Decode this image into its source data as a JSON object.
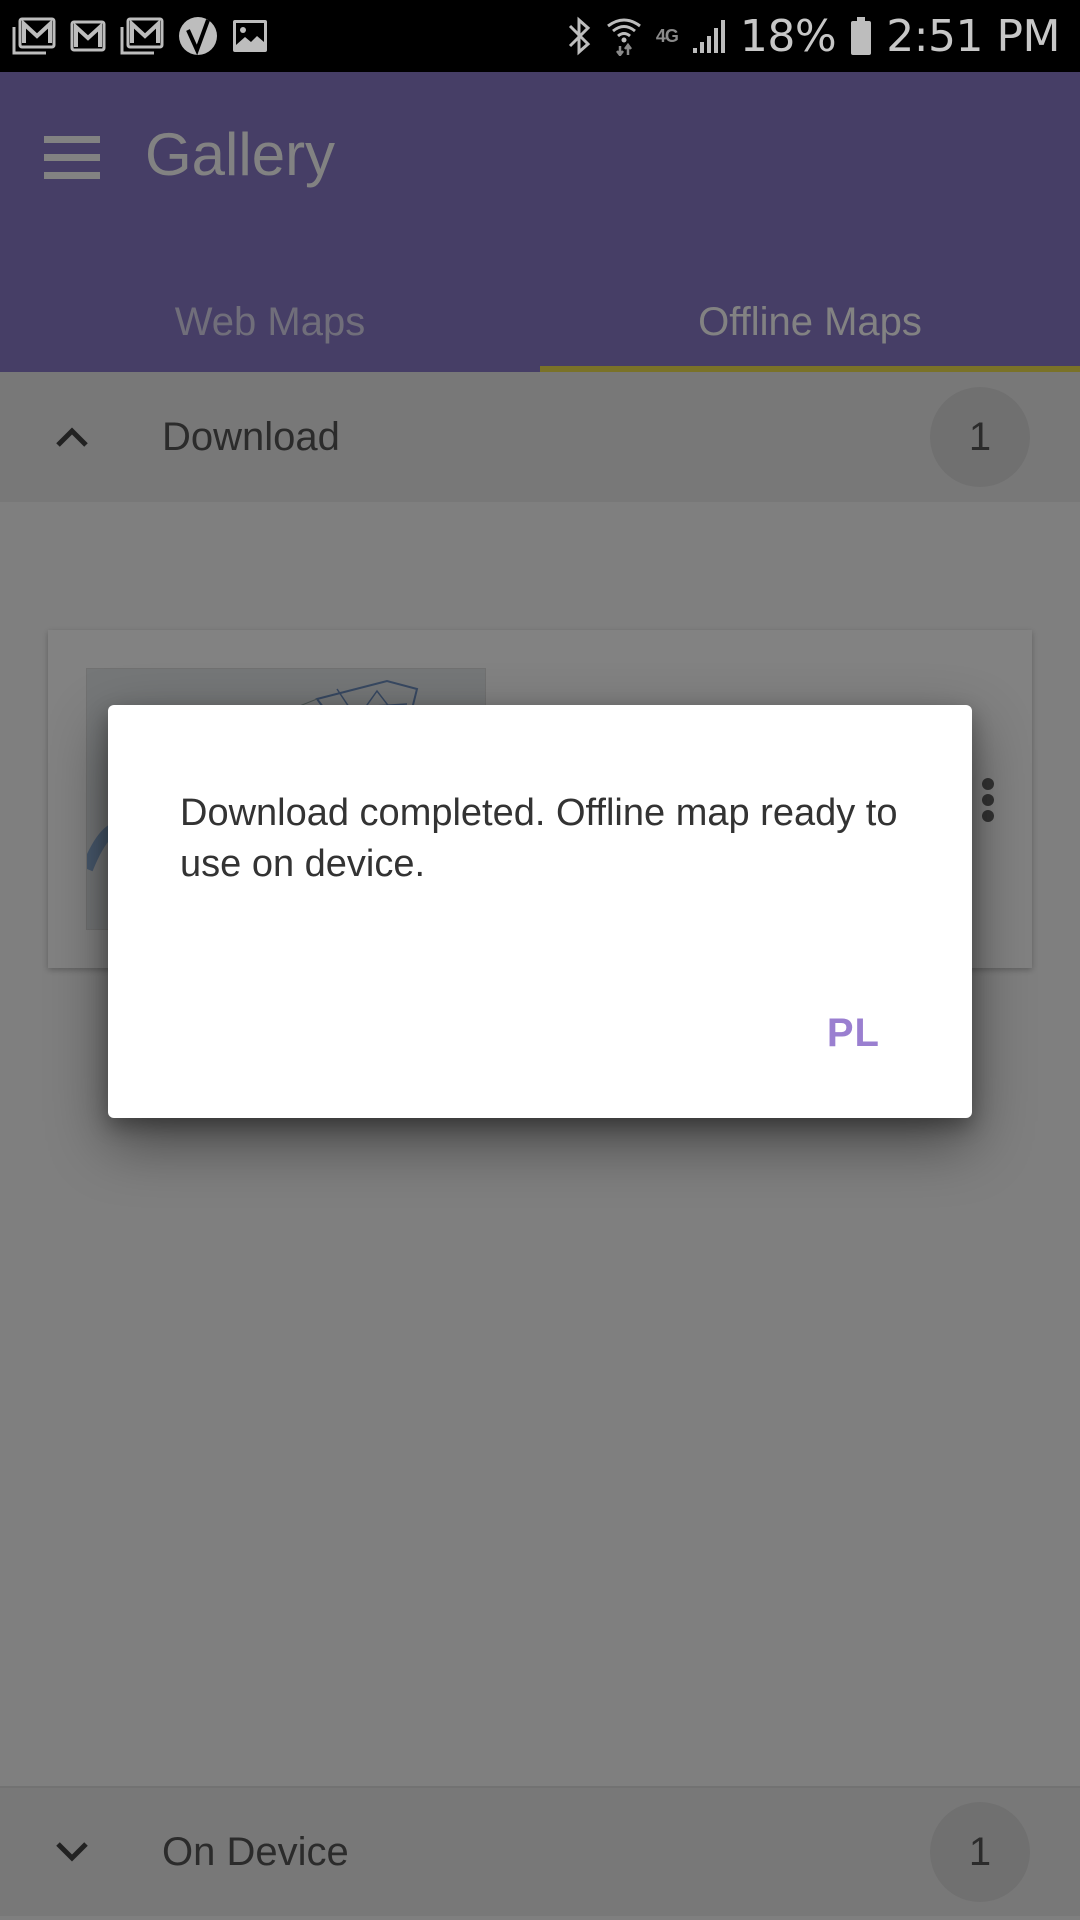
{
  "status_bar": {
    "left_icons": [
      "gmail-stack-icon",
      "gmail-icon",
      "gmail-stack-icon",
      "verizon-check-icon",
      "image-icon"
    ],
    "right_icons": [
      "bluetooth-icon",
      "wifi-icon",
      "4g-lte-icon",
      "signal-icon",
      "battery-icon"
    ],
    "network_label": "4G",
    "battery_percent": "18%",
    "time": "2:51 PM"
  },
  "app_bar": {
    "title": "Gallery",
    "menu_icon": "hamburger-menu-icon",
    "color": "#8a7ac8",
    "tabs": [
      {
        "label": "Web Maps",
        "active": false
      },
      {
        "label": "Offline Maps",
        "active": true
      }
    ],
    "tab_indicator_color": "#f0e050"
  },
  "sections": [
    {
      "label": "Download",
      "count": "1",
      "expanded": true,
      "icon": "chevron-up-icon"
    },
    {
      "label": "On Device",
      "count": "1",
      "expanded": false,
      "icon": "chevron-down-icon"
    }
  ],
  "download_card": {
    "thumbnail": "offline-map-thumbnail",
    "menu_icon": "more-vert-icon"
  },
  "dialog": {
    "message": "Download completed. Offline map ready to use on device.",
    "button_label": "PL",
    "button_color": "#9a7fd0"
  }
}
